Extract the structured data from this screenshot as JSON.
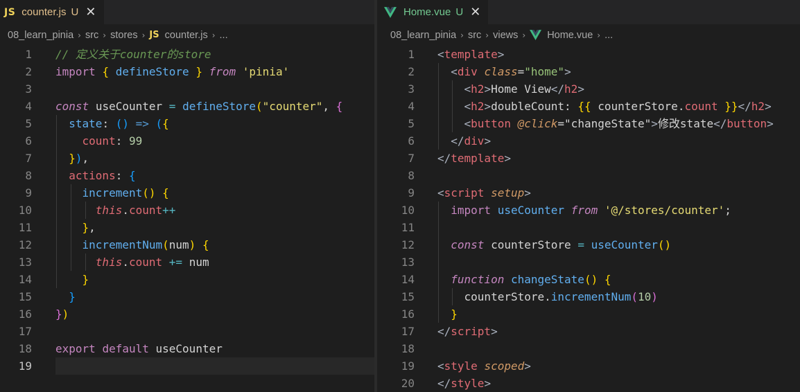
{
  "left": {
    "tab": {
      "icon": "JS",
      "label": "counter.js",
      "status": "U",
      "close": "✕"
    },
    "breadcrumb": [
      "08_learn_pinia",
      "src",
      "stores",
      "counter.js",
      "..."
    ],
    "lines": [
      "1",
      "2",
      "3",
      "4",
      "5",
      "6",
      "7",
      "8",
      "9",
      "10",
      "11",
      "12",
      "13",
      "14",
      "15",
      "16",
      "17",
      "18",
      "19"
    ],
    "code": {
      "l1": "// 定义关于counter的store",
      "l2_kw": "import",
      "l2_name": "defineStore",
      "l2_from": "from",
      "l2_str": "'pinia'",
      "l4_const": "const",
      "l4_name": "useCounter",
      "l4_fn": "defineStore",
      "l4_str": "\"counter\"",
      "l5_prop": "state",
      "l6_prop": "count",
      "l6_num": "99",
      "l8_prop": "actions",
      "l9_fn": "increment",
      "l10_this": "this",
      "l10_prop": "count",
      "l10_op": "++",
      "l12_fn": "incrementNum",
      "l12_arg": "num",
      "l13_this": "this",
      "l13_prop": "count",
      "l13_op": "+=",
      "l13_arg": "num",
      "l18_kw": "export",
      "l18_kw2": "default",
      "l18_name": "useCounter"
    }
  },
  "right": {
    "tab": {
      "label": "Home.vue",
      "status": "U",
      "close": "✕"
    },
    "breadcrumb": [
      "08_learn_pinia",
      "src",
      "views",
      "Home.vue",
      "..."
    ],
    "lines": [
      "1",
      "2",
      "3",
      "4",
      "5",
      "6",
      "7",
      "8",
      "9",
      "10",
      "11",
      "12",
      "13",
      "14",
      "15",
      "16",
      "17",
      "18",
      "19",
      "20"
    ],
    "code": {
      "template": "template",
      "div": "div",
      "class_attr": "class",
      "class_val": "\"home\"",
      "h2": "h2",
      "h2_text1": "Home View",
      "h2_text2": "doubleCount: ",
      "interp_obj": "counterStore",
      "interp_prop": "count",
      "button": "button",
      "click_attr": "@click",
      "click_val": "\"changeState\"",
      "button_text": "修改state",
      "script": "script",
      "setup": "setup",
      "import_kw": "import",
      "import_name": "useCounter",
      "from_kw": "from",
      "import_path": "'@/stores/counter'",
      "const_kw": "const",
      "store_var": "counterStore",
      "use_fn": "useCounter",
      "function_kw": "function",
      "change_fn": "changeState",
      "call_obj": "counterStore",
      "call_fn": "incrementNum",
      "call_num": "10",
      "style": "style",
      "scoped": "scoped"
    }
  }
}
